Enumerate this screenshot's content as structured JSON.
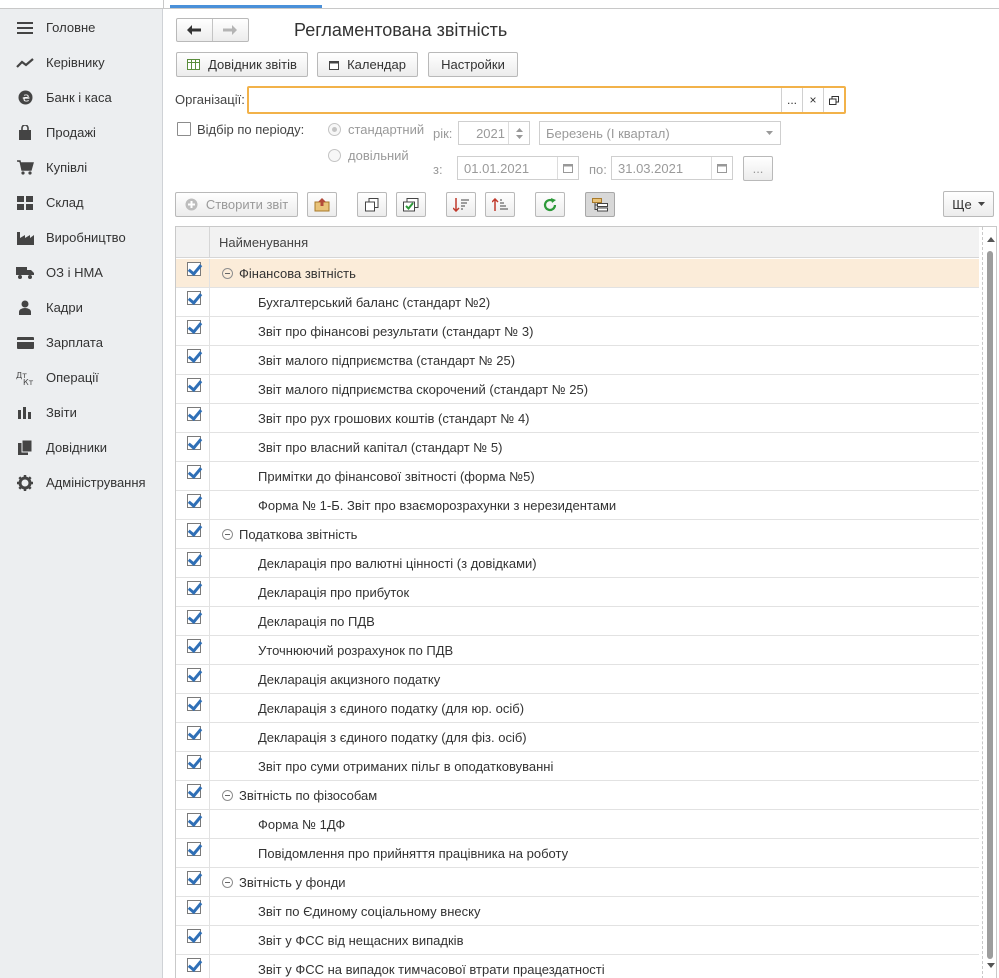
{
  "sidebar": {
    "items": [
      {
        "label": "Головне",
        "icon": "menu-icon"
      },
      {
        "label": "Керівнику",
        "icon": "trend-icon"
      },
      {
        "label": "Банк і каса",
        "icon": "coin-icon"
      },
      {
        "label": "Продажі",
        "icon": "bag-icon"
      },
      {
        "label": "Купівлі",
        "icon": "cart-icon"
      },
      {
        "label": "Склад",
        "icon": "grid-icon"
      },
      {
        "label": "Виробництво",
        "icon": "factory-icon"
      },
      {
        "label": "ОЗ і НМА",
        "icon": "truck-icon"
      },
      {
        "label": "Кадри",
        "icon": "person-icon"
      },
      {
        "label": "Зарплата",
        "icon": "card-icon"
      },
      {
        "label": "Операції",
        "icon": "dt-kt-icon"
      },
      {
        "label": "Звіти",
        "icon": "bar-chart-icon"
      },
      {
        "label": "Довідники",
        "icon": "books-icon"
      },
      {
        "label": "Адміністрування",
        "icon": "gear-icon"
      }
    ]
  },
  "header": {
    "title": "Регламентована звітність"
  },
  "toolbar": {
    "directory_label": "Довідник звітів",
    "calendar_label": "Календар",
    "settings_label": "Настройки"
  },
  "filters": {
    "org_label": "Організації:",
    "org_value": "",
    "org_select": "...",
    "org_clear": "×",
    "period_label": "Відбір по періоду:",
    "standard_label": "стандартний",
    "custom_label": "довільний",
    "year_label": "рік:",
    "year_value": "2021",
    "quarter_value": "Березень (I квартал)",
    "from_label": "з:",
    "from_value": "01.01.2021",
    "to_label": "по:",
    "to_value": "31.03.2021",
    "more_dots": "..."
  },
  "actions": {
    "create_label": "Створити звіт",
    "more_label": "Ще"
  },
  "table": {
    "header": "Найменування",
    "rows": [
      {
        "type": "group",
        "text": "Фінансова звітність",
        "selected": true
      },
      {
        "type": "item",
        "text": "Бухгалтерський баланс (стандарт №2)"
      },
      {
        "type": "item",
        "text": "Звіт про фінансові результати (стандарт № 3)"
      },
      {
        "type": "item",
        "text": "Звіт малого підприємства (стандарт № 25)"
      },
      {
        "type": "item",
        "text": "Звіт малого підприємства скорочений (стандарт № 25)"
      },
      {
        "type": "item",
        "text": "Звіт про рух грошових коштів (стандарт № 4)"
      },
      {
        "type": "item",
        "text": "Звіт про власний капітал (стандарт № 5)"
      },
      {
        "type": "item",
        "text": "Примітки до фінансової звітності (форма №5)"
      },
      {
        "type": "item",
        "text": "Форма № 1-Б. Звіт про взаєморозрахунки з нерезидентами"
      },
      {
        "type": "group",
        "text": "Податкова звітність"
      },
      {
        "type": "item",
        "text": "Декларація про валютні цінності (з довідками)"
      },
      {
        "type": "item",
        "text": "Декларація про прибуток"
      },
      {
        "type": "item",
        "text": "Декларація по ПДВ"
      },
      {
        "type": "item",
        "text": "Уточнюючий розрахунок по ПДВ"
      },
      {
        "type": "item",
        "text": "Декларація акцизного податку"
      },
      {
        "type": "item",
        "text": "Декларація з єдиного податку (для юр. осіб)"
      },
      {
        "type": "item",
        "text": "Декларація з єдиного податку (для фіз. осіб)"
      },
      {
        "type": "item",
        "text": "Звіт про суми отриманих пільг в оподатковуванні"
      },
      {
        "type": "group",
        "text": "Звітність по фізособам"
      },
      {
        "type": "item",
        "text": "Форма № 1ДФ"
      },
      {
        "type": "item",
        "text": "Повідомлення про прийняття працівника на роботу"
      },
      {
        "type": "group",
        "text": "Звітність у фонди"
      },
      {
        "type": "item",
        "text": "Звіт по Єдиному соціальному внеску"
      },
      {
        "type": "item",
        "text": "Звіт у ФСС від нещасних випадків"
      },
      {
        "type": "item",
        "text": "Звіт у ФСС на випадок тимчасової втрати працездатності"
      }
    ]
  }
}
